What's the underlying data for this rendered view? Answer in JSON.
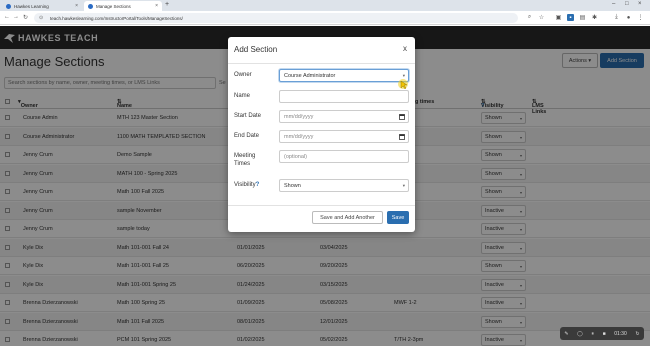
{
  "browser": {
    "tabs": [
      {
        "label": "Hawkes Learning"
      },
      {
        "label": "Manage Sections"
      }
    ],
    "url": "teach.hawkeslearning.com/InstructorPortal/Tools/ManageSections/"
  },
  "app": {
    "logo_text": "HAWKES TEACH"
  },
  "page": {
    "title": "Manage Sections",
    "actions_label": "Actions",
    "add_section_label": "Add Section",
    "search_placeholder": "Search sections by name, owner, meeting times, or LMS Links",
    "search_trail": "Se",
    "columns": {
      "owner": "Owner",
      "name": "Name",
      "meeting_times": "g times",
      "visibility": "Visibility",
      "lms_links": "LMS Links"
    },
    "rows": [
      {
        "owner": "Course Admin",
        "name": "MTH 123 Master Section",
        "start": "",
        "end": "",
        "times": "",
        "visibility": "Shown"
      },
      {
        "owner": "Course Administrator",
        "name": "1100 MATH TEMPLATED SECTION",
        "start": "",
        "end": "",
        "times": "",
        "visibility": "Shown"
      },
      {
        "owner": "Jenny Crum",
        "name": "Demo Sample",
        "start": "",
        "end": "",
        "times": "5:50",
        "visibility": "Shown"
      },
      {
        "owner": "Jenny Crum",
        "name": "MATH 100 - Spring 2025",
        "start": "",
        "end": "",
        "times": "2pm",
        "visibility": "Shown"
      },
      {
        "owner": "Jenny Crum",
        "name": "Math 100 Fall 2025",
        "start": "",
        "end": "",
        "times": "",
        "visibility": "Shown"
      },
      {
        "owner": "Jenny Crum",
        "name": "sample November",
        "start": "",
        "end": "",
        "times": "ber",
        "visibility": "Inactive"
      },
      {
        "owner": "Jenny Crum",
        "name": "sample today",
        "start": "",
        "end": "",
        "times": "ber",
        "visibility": "Inactive"
      },
      {
        "owner": "Kyle Dix",
        "name": "Math 101-001 Fall 24",
        "start": "01/01/2025",
        "end": "03/04/2025",
        "times": "",
        "visibility": "Inactive"
      },
      {
        "owner": "Kyle Dix",
        "name": "Math 101-001 Fall 25",
        "start": "06/20/2025",
        "end": "09/20/2025",
        "times": "",
        "visibility": "Shown"
      },
      {
        "owner": "Kyle Dix",
        "name": "Math 101-001 Spring 25",
        "start": "01/24/2025",
        "end": "03/15/2025",
        "times": "",
        "visibility": "Inactive"
      },
      {
        "owner": "Brenna Dzierzanowski",
        "name": "Math 100 Spring 25",
        "start": "01/09/2025",
        "end": "05/08/2025",
        "times": "MWF 1-2",
        "visibility": "Inactive"
      },
      {
        "owner": "Brenna Dzierzanowski",
        "name": "Math 101 Fall 2025",
        "start": "08/01/2025",
        "end": "12/01/2025",
        "times": "",
        "visibility": "Shown"
      },
      {
        "owner": "Brenna Dzierzanowski",
        "name": "PCM 101 Spring 2025",
        "start": "01/02/2025",
        "end": "05/02/2025",
        "times": "T/TH 2-3pm",
        "visibility": "Inactive"
      }
    ]
  },
  "modal": {
    "title": "Add Section",
    "close": "x",
    "owner_label": "Owner",
    "owner_value": "Course Administrator",
    "name_label": "Name",
    "name_value": "",
    "start_label": "Start Date",
    "start_placeholder": "mm/dd/yyyy",
    "end_label": "End Date",
    "end_placeholder": "mm/dd/yyyy",
    "meeting_label_1": "Meeting",
    "meeting_label_2": "Times",
    "meeting_placeholder": "(optional)",
    "visibility_label": "Visibility",
    "visibility_value": "Shown",
    "save_add_another_label": "Save and Add Another",
    "save_label": "Save"
  },
  "recorder": {
    "time": "01:30"
  },
  "colors": {
    "primary": "#2a6eb0",
    "header_bg": "#2b2b2b",
    "cursor_highlight": "#f2d21b"
  }
}
